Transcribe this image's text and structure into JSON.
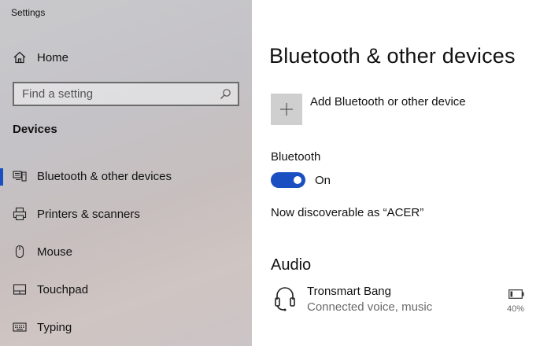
{
  "window": {
    "title": "Settings"
  },
  "sidebar": {
    "home_label": "Home",
    "search": {
      "placeholder": "Find a setting"
    },
    "section": "Devices",
    "items": [
      {
        "label": "Bluetooth & other devices",
        "icon": "bluetooth-devices-icon",
        "selected": true
      },
      {
        "label": "Printers & scanners",
        "icon": "printer-icon",
        "selected": false
      },
      {
        "label": "Mouse",
        "icon": "mouse-icon",
        "selected": false
      },
      {
        "label": "Touchpad",
        "icon": "touchpad-icon",
        "selected": false
      },
      {
        "label": "Typing",
        "icon": "keyboard-icon",
        "selected": false
      }
    ]
  },
  "main": {
    "title": "Bluetooth & other devices",
    "add_device_label": "Add Bluetooth or other device",
    "bluetooth": {
      "label": "Bluetooth",
      "state": "On",
      "enabled": true
    },
    "discoverable_text": "Now discoverable as “ACER”",
    "audio": {
      "heading": "Audio",
      "devices": [
        {
          "name": "Tronsmart Bang",
          "status": "Connected voice, music",
          "battery": "40%",
          "icon": "headset-icon"
        }
      ]
    }
  },
  "colors": {
    "accent": "#1a4fc2",
    "tile": "#cfcfcf"
  }
}
